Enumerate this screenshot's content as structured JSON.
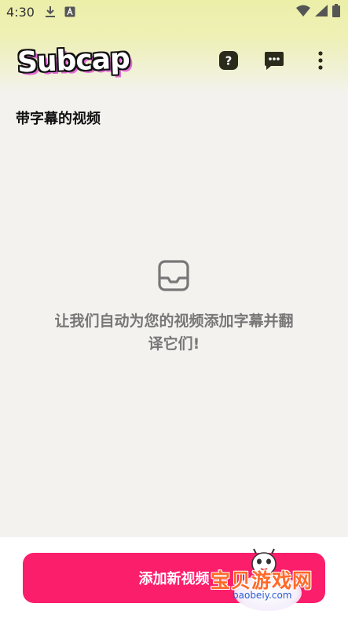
{
  "status_bar": {
    "time": "4:30"
  },
  "app_bar": {
    "logo_text": "Subcap"
  },
  "section": {
    "title": "带字幕的视频"
  },
  "empty_state": {
    "line1": "让我们自动为您的视频添加字幕并翻",
    "line2": "译它们!"
  },
  "primary_action": {
    "label": "添加新视频"
  },
  "watermark": {
    "site_name": "宝贝游戏网",
    "url": "baobeiy.com"
  },
  "colors": {
    "accent": "#fb1e6b",
    "header_tint": "#ecefa8",
    "background": "#f3f2ef"
  }
}
